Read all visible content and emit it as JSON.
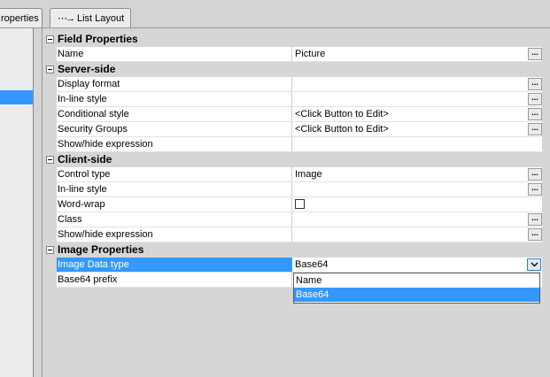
{
  "tabs": [
    {
      "label": "roperties"
    },
    {
      "label": "List Layout",
      "icon": "list-layout-icon"
    }
  ],
  "categories": {
    "field": "Field Properties",
    "server": "Server-side",
    "client": "Client-side",
    "image": "Image Properties"
  },
  "props": {
    "name": {
      "label": "Name",
      "value": "Picture"
    },
    "display_format": {
      "label": "Display format",
      "value": ""
    },
    "inline_style_server": {
      "label": "In-line style",
      "value": ""
    },
    "conditional_style": {
      "label": "Conditional style",
      "value": "<Click Button to Edit>"
    },
    "security_groups": {
      "label": "Security Groups",
      "value": "<Click Button to Edit>"
    },
    "showhide_server": {
      "label": "Show/hide expression",
      "value": ""
    },
    "control_type": {
      "label": "Control type",
      "value": "Image"
    },
    "inline_style_client": {
      "label": "In-line style",
      "value": ""
    },
    "word_wrap": {
      "label": "Word-wrap",
      "checked": false
    },
    "class": {
      "label": "Class",
      "value": ""
    },
    "showhide_client": {
      "label": "Show/hide expression",
      "value": ""
    },
    "image_data_type": {
      "label": "Image Data type",
      "value": "Base64"
    },
    "base64_prefix": {
      "label": "Base64 prefix",
      "value": ""
    }
  },
  "ellipsis": "...",
  "dropdown": {
    "options": [
      "Name",
      "Base64"
    ],
    "selected": "Base64"
  }
}
